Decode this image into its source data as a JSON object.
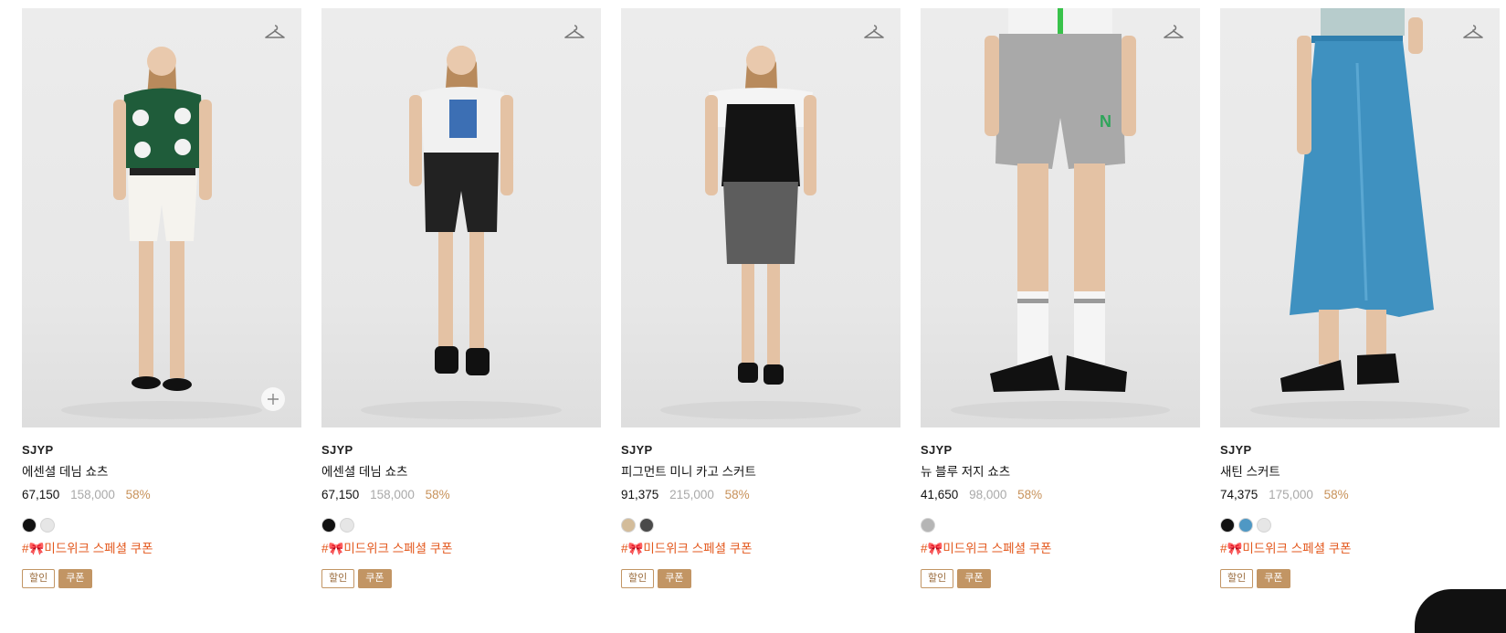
{
  "products": [
    {
      "brand": "SJYP",
      "name": "에센셜 데님 쇼츠",
      "price": "67,150",
      "original_price": "158,000",
      "discount": "58%",
      "colors": [
        "#111111",
        "#e6e6e6"
      ],
      "coupon_text": "#🎀미드위크 스페셜 쿠폰",
      "badge_sale": "할인",
      "badge_coupon": "쿠폰",
      "image_desc": "green flower cardigan, white denim shorts"
    },
    {
      "brand": "SJYP",
      "name": "에센셜 데님 쇼츠",
      "price": "67,150",
      "original_price": "158,000",
      "discount": "58%",
      "colors": [
        "#111111",
        "#e6e6e6"
      ],
      "coupon_text": "#🎀미드위크 스페셜 쿠폰",
      "badge_sale": "할인",
      "badge_coupon": "쿠폰",
      "image_desc": "white graphic tee, black denim shorts"
    },
    {
      "brand": "SJYP",
      "name": "피그먼트 미니 카고 스커트",
      "price": "91,375",
      "original_price": "215,000",
      "discount": "58%",
      "colors": [
        "#d3bc9a",
        "#4a4a4a"
      ],
      "coupon_text": "#🎀미드위크 스페셜 쿠폰",
      "badge_sale": "할인",
      "badge_coupon": "쿠폰",
      "image_desc": "black camisole, grey mini cargo skirt"
    },
    {
      "brand": "SJYP",
      "name": "뉴 블루 저지 쇼츠",
      "price": "41,650",
      "original_price": "98,000",
      "discount": "58%",
      "colors": [
        "#b5b5b5"
      ],
      "coupon_text": "#🎀미드위크 스페셜 쿠폰",
      "badge_sale": "할인",
      "badge_coupon": "쿠폰",
      "image_desc": "grey jersey shorts, white socks, black sandals"
    },
    {
      "brand": "SJYP",
      "name": "새틴 스커트",
      "price": "74,375",
      "original_price": "175,000",
      "discount": "58%",
      "colors": [
        "#111111",
        "#4f98c4",
        "#e6e6e6"
      ],
      "coupon_text": "#🎀미드위크 스페셜 쿠폰",
      "badge_sale": "할인",
      "badge_coupon": "쿠폰",
      "image_desc": "blue satin midi skirt, black sandals"
    }
  ],
  "icons": {
    "wishlist": "hanger-icon",
    "quick_add": "plus-icon"
  }
}
